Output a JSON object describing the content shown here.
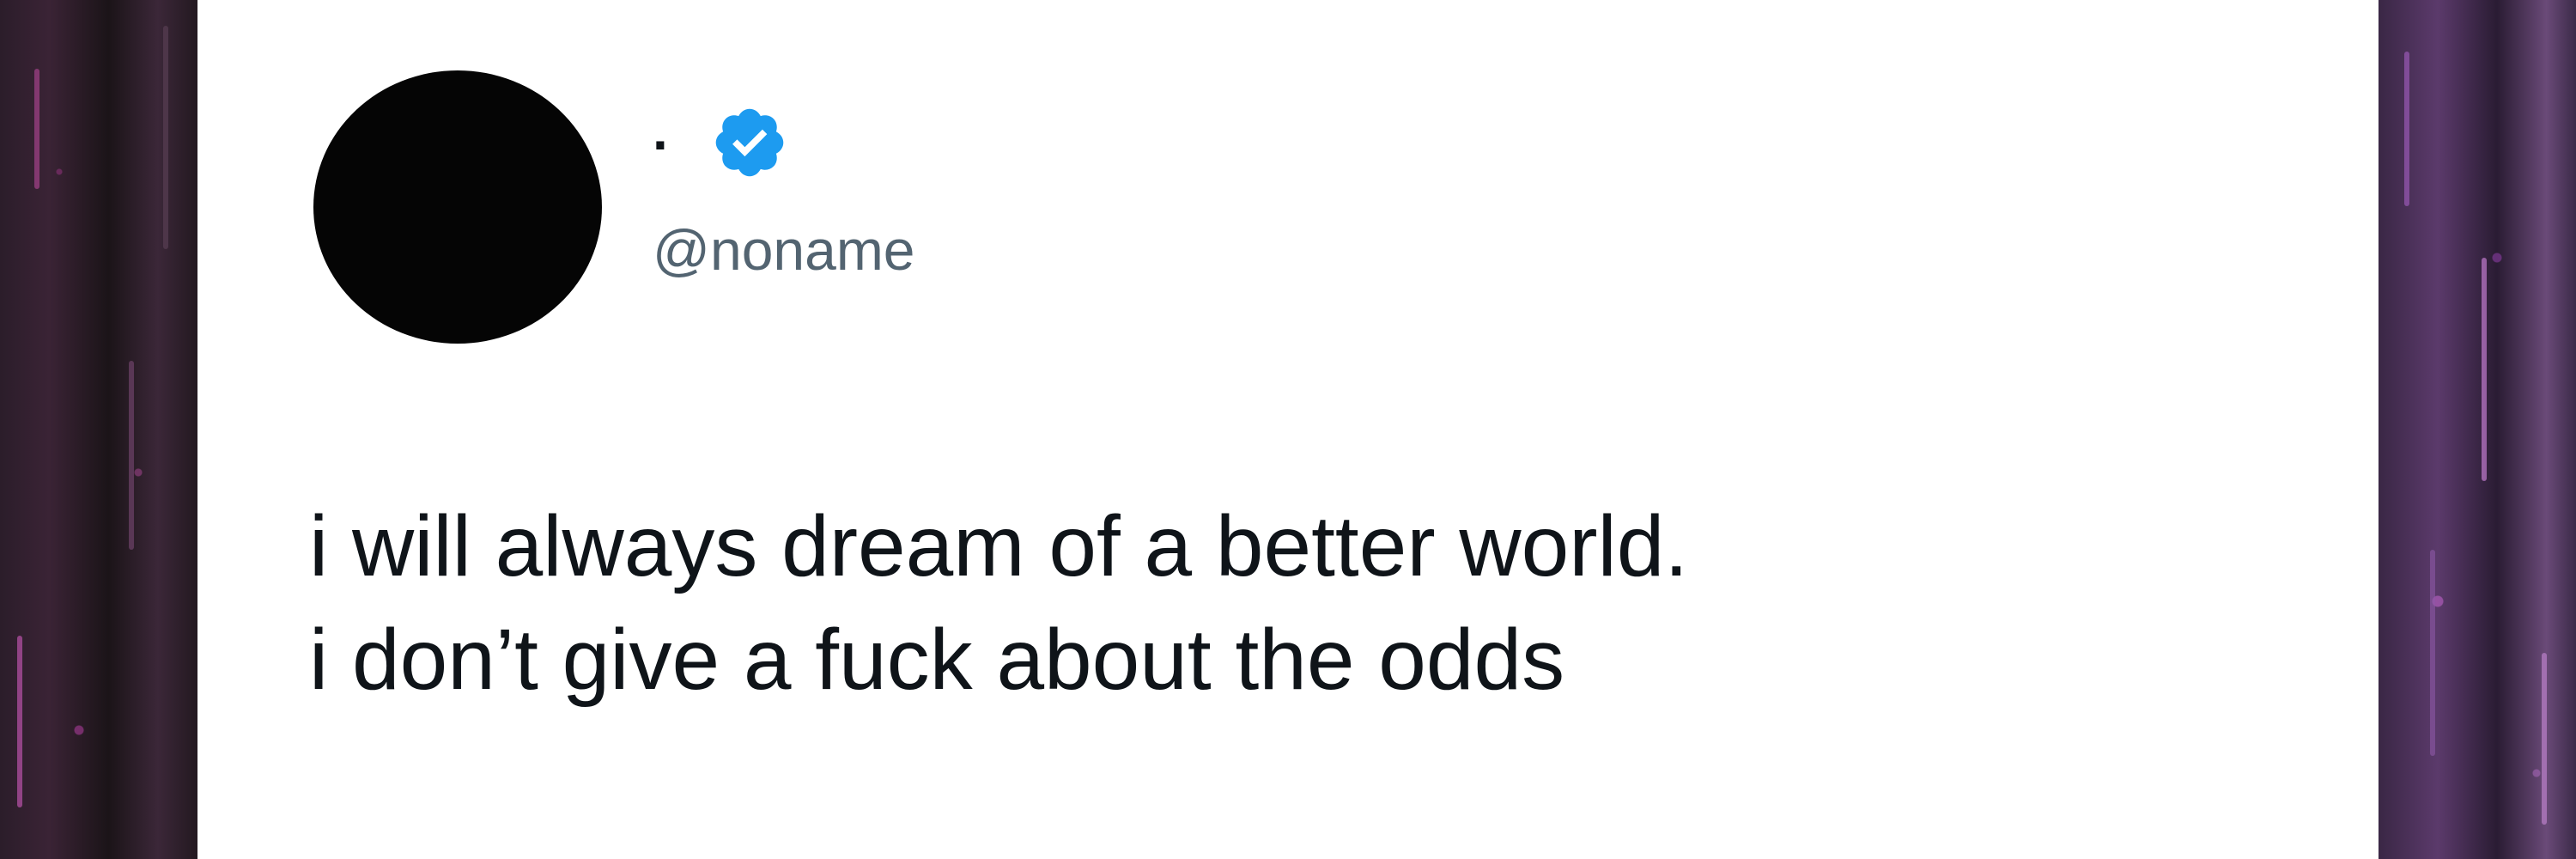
{
  "tweet": {
    "author": {
      "display_name": ".",
      "handle": "@noname",
      "verified": true,
      "verified_color": "#1d9bf0",
      "avatar_color": "#050505"
    },
    "text_lines": [
      "i will always dream of a better world.",
      "i don’t give a fuck about the odds"
    ]
  },
  "colors": {
    "card_background": "#ffffff",
    "text_primary": "#0f1419",
    "text_secondary": "#536471",
    "side_background_accent": "#c83caa"
  }
}
